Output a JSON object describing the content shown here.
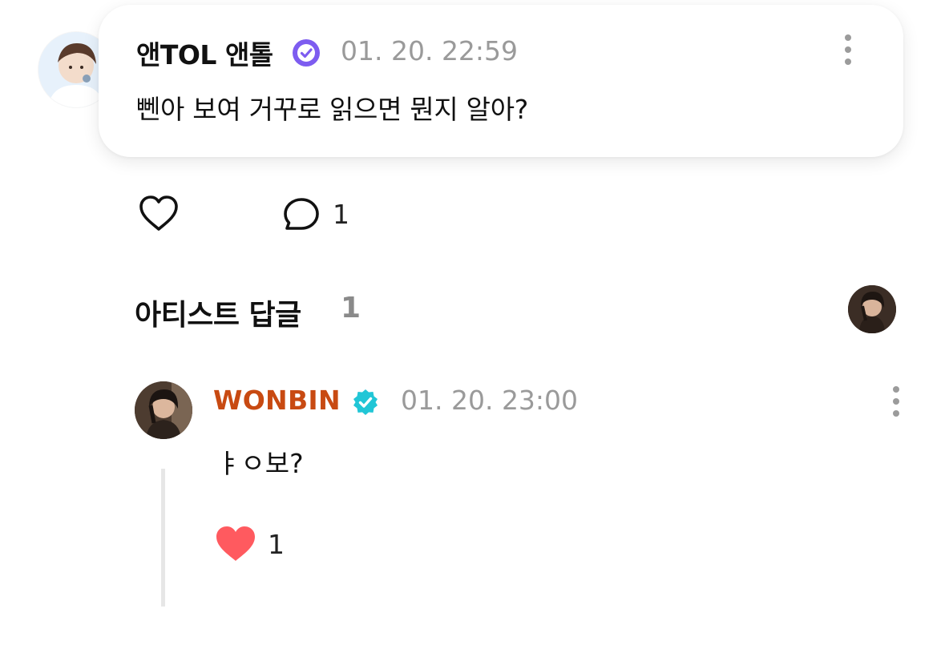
{
  "post": {
    "author": "앤TOL 앤톨",
    "timestamp": "01. 20. 22:59",
    "body": "뻰아 보여 거꾸로 읽으면 뭔지 알아?",
    "comment_count": "1",
    "icons": {
      "verified": "verified-badge-icon",
      "like": "heart-outline-icon",
      "comment": "speech-bubble-icon",
      "more": "more-vertical-icon"
    }
  },
  "artist_replies": {
    "title": "아티스트 답글",
    "count": "1"
  },
  "reply": {
    "author": "WONBIN",
    "timestamp": "01. 20. 23:00",
    "body": "ㅑㅇ보?",
    "like_count": "1",
    "icons": {
      "verified": "verified-badge-icon",
      "like": "heart-filled-icon",
      "more": "more-vertical-icon"
    }
  },
  "colors": {
    "artist_name": "#c84a12",
    "fan_verified": "#7d5cf0",
    "artist_verified": "#21c6d6",
    "liked_heart": "#ff5a5f",
    "muted_text": "#9a9a9a"
  }
}
